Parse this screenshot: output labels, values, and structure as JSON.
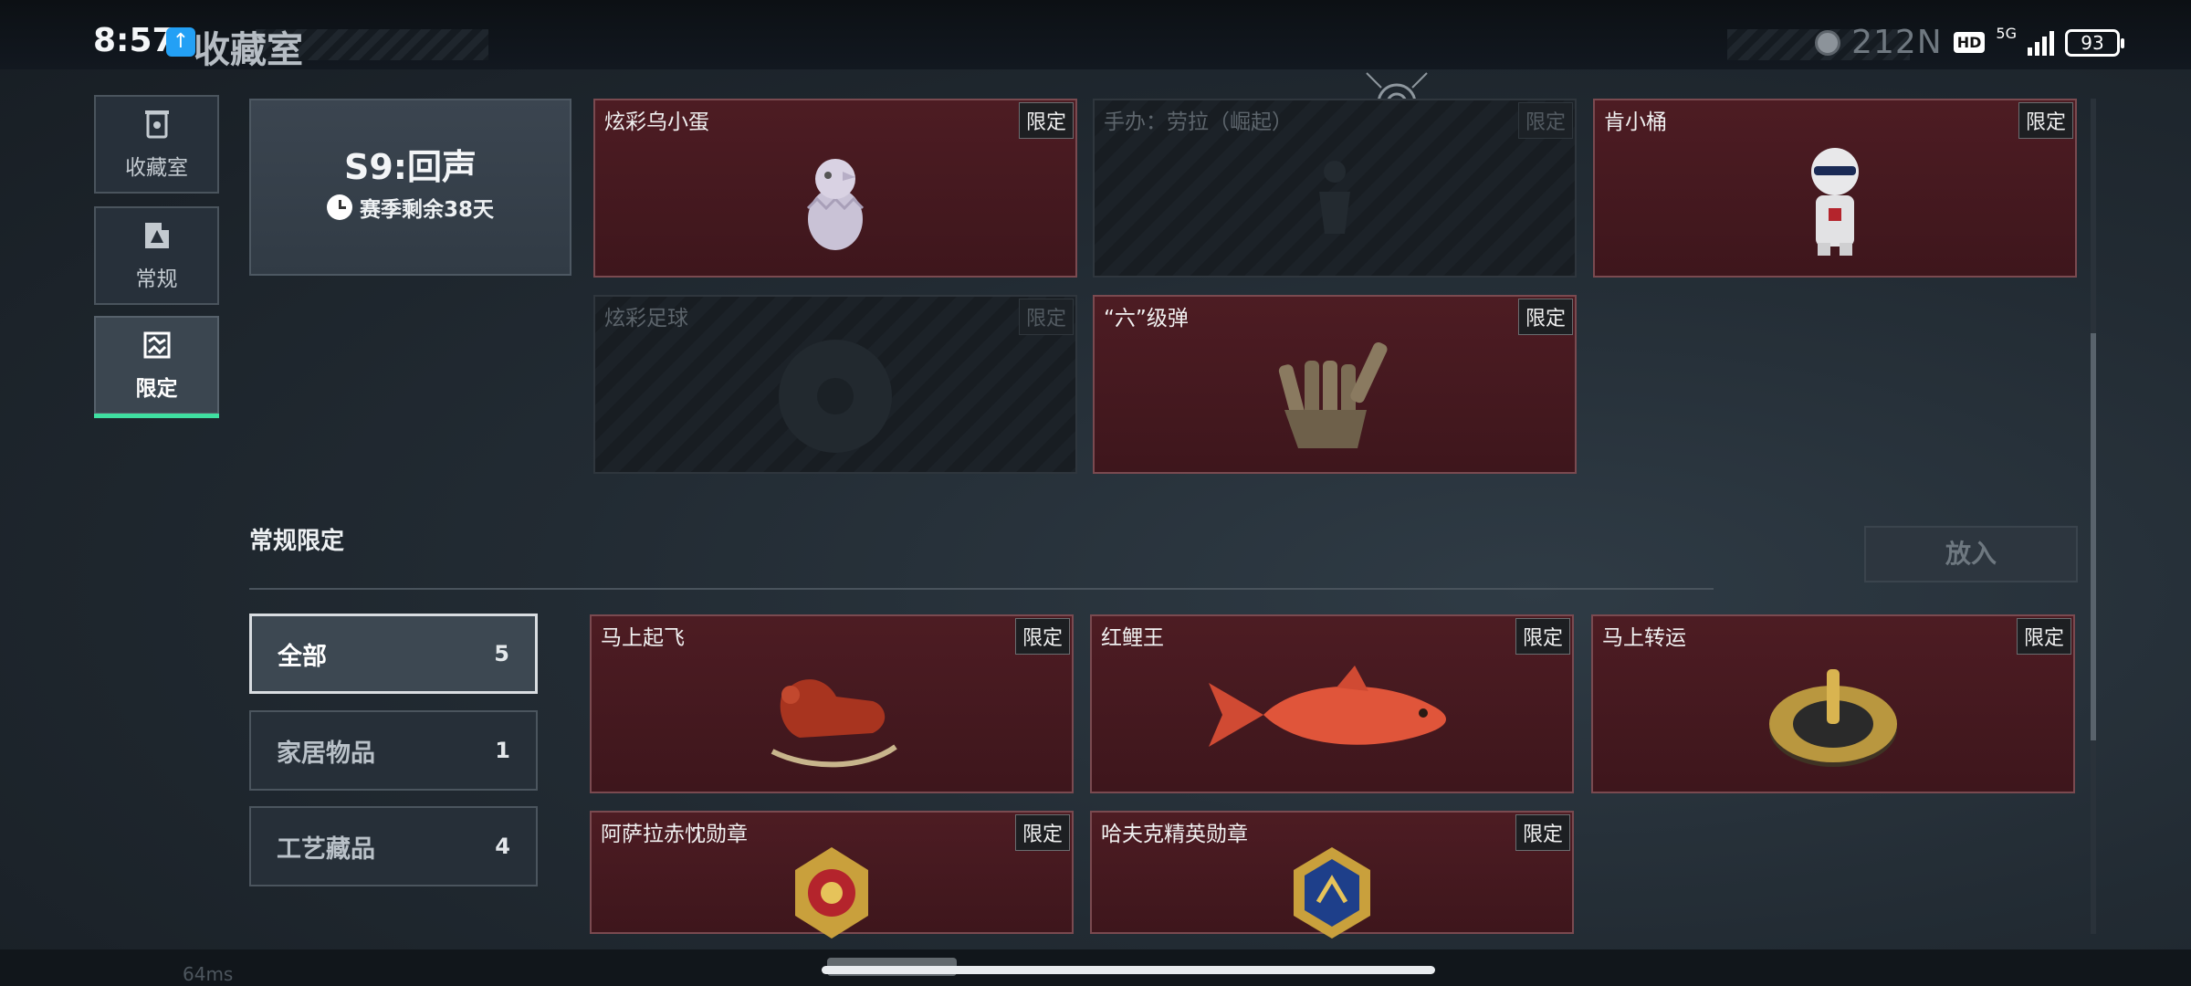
{
  "status_bar": {
    "time": "8:57",
    "title": "收藏室",
    "obscured_number": "212N",
    "network": "5G",
    "hd": "HD",
    "battery": "93"
  },
  "sidebar": {
    "items": [
      {
        "label": "收藏室",
        "icon": "trash-bin-icon",
        "active": false
      },
      {
        "label": "常规",
        "icon": "picture-frame-icon",
        "active": false
      },
      {
        "label": "限定",
        "icon": "limited-frame-icon",
        "active": true
      }
    ]
  },
  "season": {
    "title": "S9:回声",
    "remaining": "赛季剩余38天"
  },
  "season_items": [
    {
      "name": "炫彩乌小蛋",
      "tag": "限定",
      "owned": true,
      "art": "chick-egg-figure"
    },
    {
      "name": "手办：劳拉（崛起）",
      "tag": "限定",
      "owned": false,
      "art": "figure-silhouette"
    },
    {
      "name": "肯小桶",
      "tag": "限定",
      "owned": true,
      "art": "colonel-figure"
    },
    {
      "name": "炫彩足球",
      "tag": "限定",
      "owned": false,
      "art": "football-silhouette"
    },
    {
      "name": "“六”级弹",
      "tag": "限定",
      "owned": true,
      "art": "bullet-hand"
    }
  ],
  "regular_section": {
    "title": "常规限定",
    "place_button": "放入"
  },
  "filters": [
    {
      "label": "全部",
      "count": "5",
      "active": true
    },
    {
      "label": "家居物品",
      "count": "1",
      "active": false
    },
    {
      "label": "工艺藏品",
      "count": "4",
      "active": false
    }
  ],
  "regular_items": [
    {
      "name": "马上起飞",
      "tag": "限定",
      "art": "rocking-horse"
    },
    {
      "name": "红鲤王",
      "tag": "限定",
      "art": "red-carp"
    },
    {
      "name": "马上转运",
      "tag": "限定",
      "art": "golden-wheel"
    },
    {
      "name": "阿萨拉赤忱勋章",
      "tag": "限定",
      "art": "red-gold-medal"
    },
    {
      "name": "哈夫克精英勋章",
      "tag": "限定",
      "art": "blue-gold-medal"
    }
  ],
  "footer": {
    "ping": "64ms"
  }
}
